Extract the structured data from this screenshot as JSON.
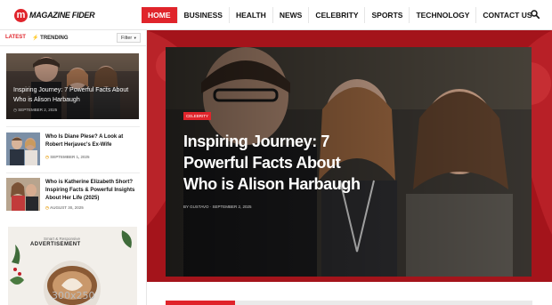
{
  "brand": {
    "logo_letter": "m",
    "logo_text": "MAGAZINE FIDER",
    "accent": "#e0242b"
  },
  "nav": {
    "items": [
      "HOME",
      "BUSINESS",
      "HEALTH",
      "NEWS",
      "CELEBRITY",
      "SPORTS",
      "TECHNOLOGY",
      "CONTACT US"
    ],
    "active": "HOME"
  },
  "sidebar": {
    "tab_latest": "LATEST",
    "tab_trending": "TRENDING",
    "filter_label": "Filter",
    "featured": {
      "title": "Inspiring Journey: 7 Powerful Facts About Who is Alison Harbaugh",
      "date": "SEPTEMBER 2, 2025"
    },
    "items": [
      {
        "title": "Who Is Diane Plese? A Look at Robert Herjavec's Ex-Wife",
        "date": "SEPTEMBER 1, 2025"
      },
      {
        "title": "Who is Katherine Elizabeth Short? Inspiring Facts & Powerful Insights About Her Life (2025)",
        "date": "AUGUST 30, 2025"
      }
    ],
    "ad": {
      "small": "Smart & Responsive",
      "big": "ADVERTISEMENT",
      "size": "300x250"
    }
  },
  "hero": {
    "category": "CELEBRITY",
    "title": "Inspiring Journey: 7 Powerful Facts About Who is Alison Harbaugh",
    "meta": "BY GUSTAVO · SEPTEMBER 2, 2025"
  }
}
